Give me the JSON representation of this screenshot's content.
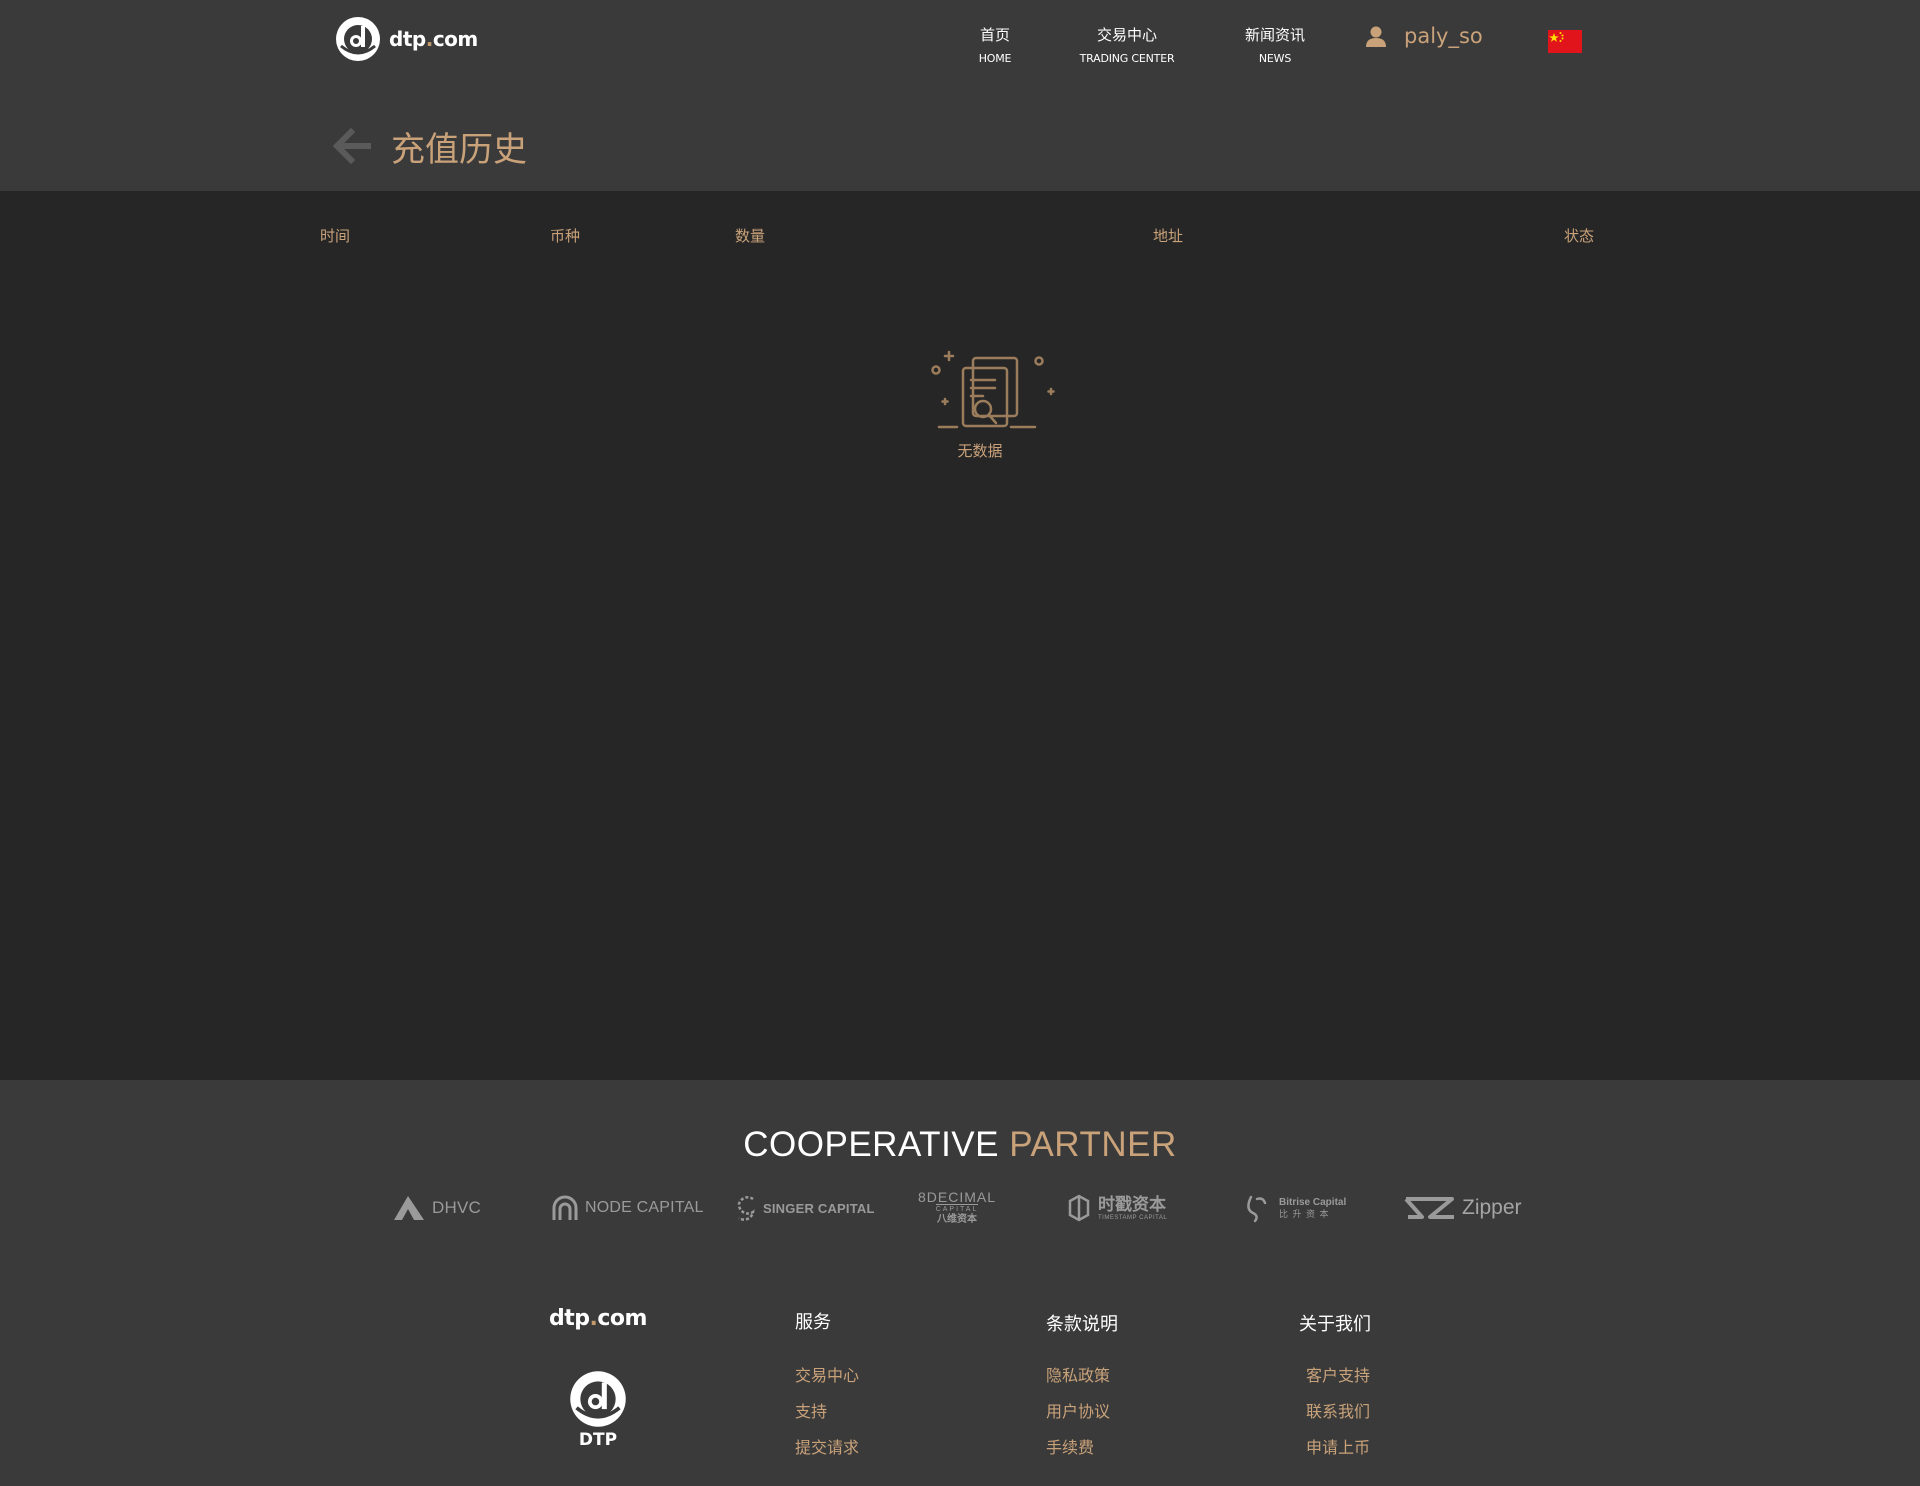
{
  "brand": {
    "name_prefix": "dtp",
    "name_dot": ".",
    "name_suffix": "com",
    "mark_label": "DTP"
  },
  "nav": [
    {
      "zh": "首页",
      "en": "HOME"
    },
    {
      "zh": "交易中心",
      "en": "TRADING CENTER"
    },
    {
      "zh": "新闻资讯",
      "en": "NEWS"
    }
  ],
  "user": {
    "name": "paly_so",
    "icon": "user-icon"
  },
  "language": {
    "flag": "china-flag",
    "color": "#e1141b"
  },
  "page": {
    "title": "充值历史",
    "back_icon": "arrow-left-icon"
  },
  "table": {
    "columns": [
      "时间",
      "币种",
      "数量",
      "地址",
      "状态"
    ],
    "rows": [],
    "empty_text": "无数据"
  },
  "partners": {
    "title_main": "COOPERATIVE",
    "title_accent": "PARTNER",
    "items": [
      {
        "name": "DHVC"
      },
      {
        "name": "NODE CAPITAL"
      },
      {
        "name": "SINGER CAPITAL"
      },
      {
        "name": "8DECIMAL",
        "sub1": "CAPITAL",
        "sub2": "八维资本"
      },
      {
        "name": "时戳资本",
        "sub1": "TIMESTAMP CAPITAL"
      },
      {
        "name": "Bitrise Capital",
        "sub1": "比 升 资 本"
      },
      {
        "name": "Zipper"
      }
    ]
  },
  "footer": {
    "columns": [
      {
        "title": "服务",
        "links": [
          "交易中心",
          "支持",
          "提交请求"
        ]
      },
      {
        "title": "条款说明",
        "links": [
          "隐私政策",
          "用户协议",
          "手续费"
        ]
      },
      {
        "title": "关于我们",
        "links": [
          "客户支持",
          "联系我们",
          "申请上币"
        ]
      }
    ]
  },
  "colors": {
    "accent": "#c9a27a",
    "header_bg": "#3a3a3a",
    "body_bg": "#262626"
  }
}
